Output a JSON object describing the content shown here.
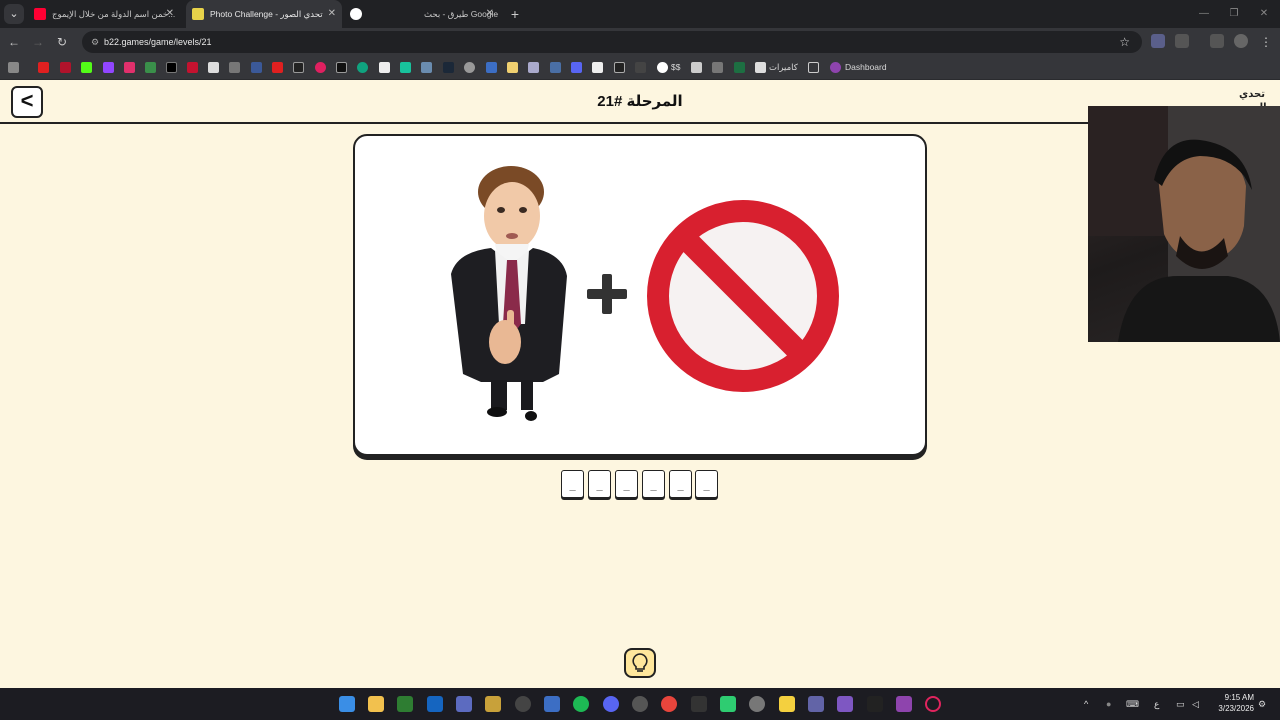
{
  "browser": {
    "tabs": [
      {
        "title": "خمن اسم الدولة من خلال الإيموج...",
        "favicon_color": "#ff0033",
        "active": false
      },
      {
        "title": "Photo Challenge - تحدي الصور",
        "favicon_color": "#e8d34a",
        "active": true
      },
      {
        "title": "",
        "favicon_color": "#ffffff",
        "active": false
      },
      {
        "title": "طيرق - بحث Google",
        "favicon_color": "#35363a",
        "active": false
      }
    ],
    "new_tab": "+",
    "url": "b22.games/game/levels/21",
    "bookmarks": {
      "folder1": "كاميرات",
      "folder2": "Dashboard",
      "dollar": "$$"
    }
  },
  "game": {
    "back_label": "<",
    "level_title": "المرحلة #21",
    "logo_text": "تحدي الصور",
    "puzzle": {
      "left_image": "man-in-suit",
      "operator": "+",
      "right_image": "prohibition-sign"
    },
    "answer_slots": [
      "_",
      "_",
      "_",
      "_",
      "_",
      "_"
    ],
    "hint_icon": "lightbulb-icon"
  },
  "taskbar": {
    "lang": "ع",
    "time": "9:15 AM",
    "date": "3/23/2026"
  },
  "colors": {
    "page_bg": "#fdf6e0",
    "no_sign_red": "#d8202f",
    "hint_bg": "#ffe79c"
  }
}
